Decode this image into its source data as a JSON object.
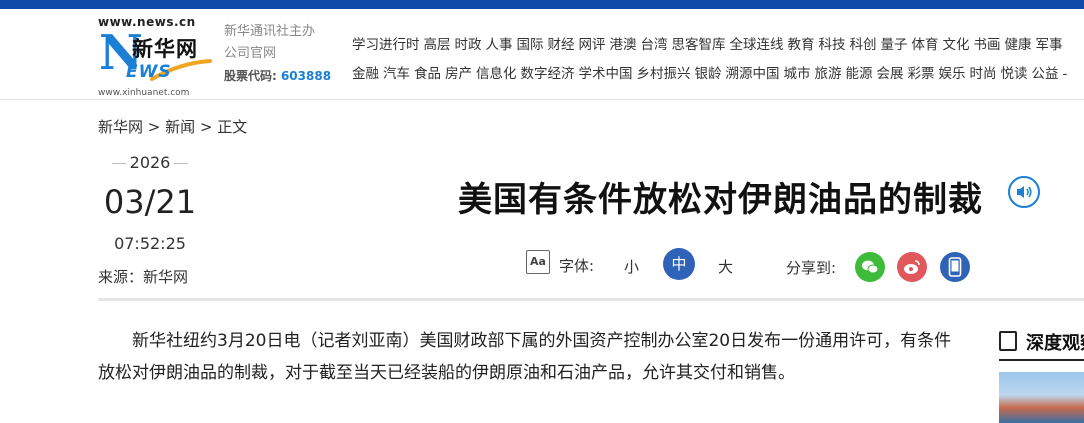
{
  "header": {
    "logo_url_top": "www.news.cn",
    "logo_letter": "N",
    "logo_cn": "新华网",
    "logo_ews": "EWS",
    "logo_url_bottom": "www.xinhuanet.com",
    "org_line1": "新华通讯社主办",
    "org_line2": "公司官网",
    "stock_label": "股票代码:",
    "stock_code": "603888",
    "nav_row1": [
      "学习进行时",
      "高层",
      "时政",
      "人事",
      "国际",
      "财经",
      "网评",
      "港澳",
      "台湾",
      "思客智库",
      "全球连线",
      "教育",
      "科技",
      "科创",
      "量子",
      "体育",
      "文化",
      "书画",
      "健康",
      "军事"
    ],
    "nav_row2": [
      "金融",
      "汽车",
      "食品",
      "房产",
      "信息化",
      "数字经济",
      "学术中国",
      "乡村振兴",
      "银龄",
      "溯源中国",
      "城市",
      "旅游",
      "能源",
      "会展",
      "彩票",
      "娱乐",
      "时尚",
      "悦读",
      "公益",
      "-"
    ]
  },
  "breadcrumb": "新华网 > 新闻 > 正文",
  "date": {
    "year": "2026",
    "month_day": "03/21",
    "time": "07:52:25"
  },
  "source": "来源：新华网",
  "article": {
    "title": "美国有条件放松对伊朗油品的制裁",
    "paragraph": "新华社纽约3月20日电（记者刘亚南）美国财政部下属的外国资产控制办公室20日发布一份通用许可，有条件放松对伊朗油品的制裁，对于截至当天已经装船的伊朗原油和石油产品，允许其交付和销售。"
  },
  "font_controls": {
    "icon_text": "Aa",
    "label": "字体:",
    "small": "小",
    "medium": "中",
    "large": "大"
  },
  "share": {
    "label": "分享到:"
  },
  "sidebar": {
    "title": "深度观察"
  },
  "colors": {
    "brand_blue": "#0f4aa8",
    "accent": "#1b7fd6",
    "wechat": "#3dbb3b",
    "weibo": "#e0585b",
    "mobile": "#2e63b8"
  }
}
